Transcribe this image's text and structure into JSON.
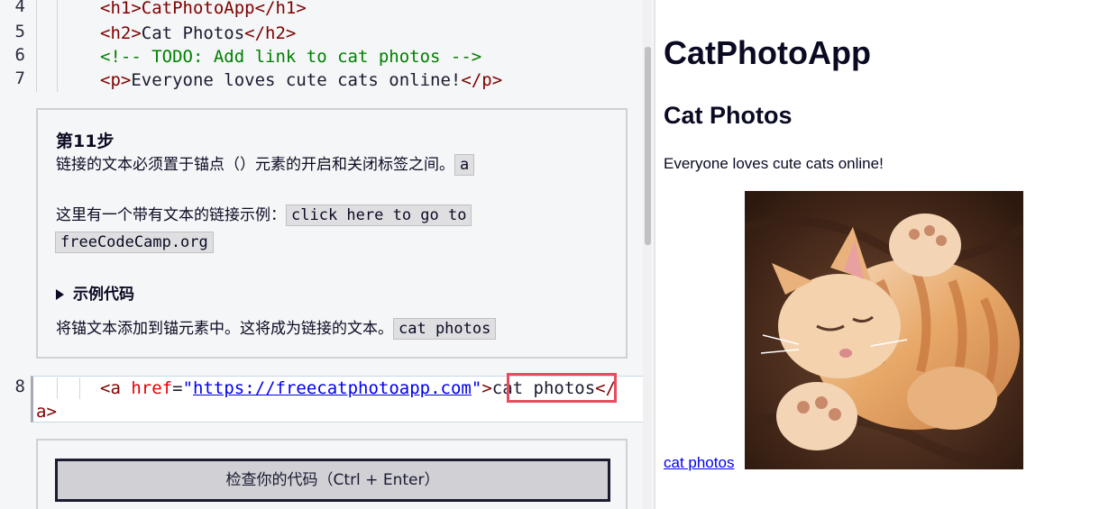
{
  "editor": {
    "lines": [
      {
        "num": "4",
        "code": "<h1>CatPhotoApp</h1>"
      },
      {
        "num": "5",
        "open": "<h2>",
        "text": "Cat Photos",
        "close": "</h2>"
      },
      {
        "num": "6",
        "comment": "<!-- TODO: Add link to cat photos -->"
      },
      {
        "num": "7",
        "open": "<p>",
        "text": "Everyone loves cute cats online!",
        "close": "</p>"
      }
    ],
    "editable_line": {
      "num": "8",
      "tag_open": "<a",
      "attr": "href",
      "eq": "=",
      "quote1": "\"",
      "url": "https://freecatphotoapp.com",
      "quote2": "\"",
      "gt": ">",
      "text": "cat photos",
      "close_start": "</",
      "close_end": "a>"
    }
  },
  "instructions": {
    "step_title": "第11步",
    "p1": "链接的文本必须置于锚点（）元素的开启和关闭标签之间。",
    "p1_code": "a",
    "p2": "这里有一个带有文本的链接示例：",
    "p2_code_a": "click here to go to",
    "p2_code_b": "freeCodeCamp.org",
    "details_label": "示例代码",
    "p3": "将锚文本添加到锚元素中。这将成为链接的文本。",
    "p3_code": "cat photos"
  },
  "check_button": "检查你的代码（Ctrl + Enter）",
  "preview": {
    "h1": "CatPhotoApp",
    "h2": "Cat Photos",
    "paragraph": "Everyone loves cute cats online!",
    "link_text": "cat photos"
  },
  "colors": {
    "highlight": "#e74c5e",
    "tag": "#800000",
    "comment": "#008000",
    "attr": "#e50000",
    "url": "#0000ee"
  }
}
